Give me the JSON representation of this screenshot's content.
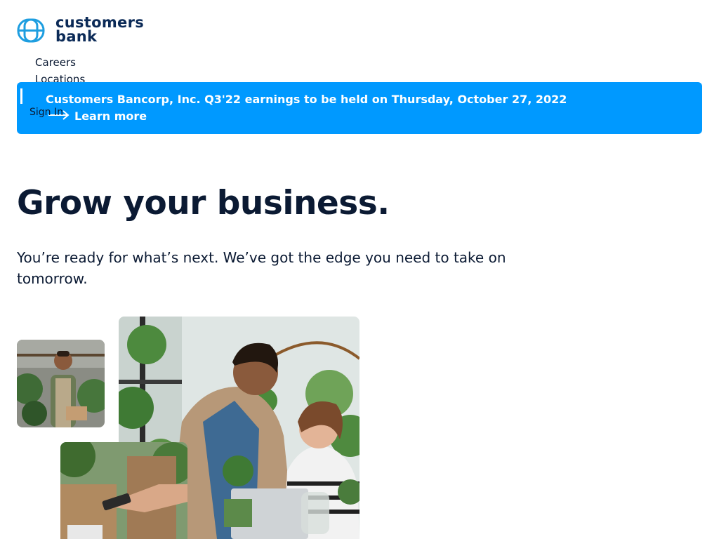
{
  "logo": {
    "line1": "customers",
    "line2": "bank",
    "brand_color": "#0b2a57",
    "mark_color": "#1e9ee0",
    "icon": "customers-bank-logo-mark"
  },
  "nav": {
    "careers": "Careers",
    "locations": "Locations",
    "sign_in": "Sign In"
  },
  "banner": {
    "text": "Customers Bancorp, Inc. Q3'22 earnings to be held on Thursday, October 27, 2022",
    "link_label": "Learn more",
    "arrow_icon": "arrow-right-icon",
    "background": "#0099ff"
  },
  "hero": {
    "title": "Grow your business.",
    "subtitle": "You’re ready for what’s next. We’ve got the edge you need to take on tomorrow."
  },
  "images": {
    "photo_1": "florist-portrait",
    "photo_2": "plant-shop-owners-at-laptop",
    "photo_3": "card-payment-at-register"
  }
}
